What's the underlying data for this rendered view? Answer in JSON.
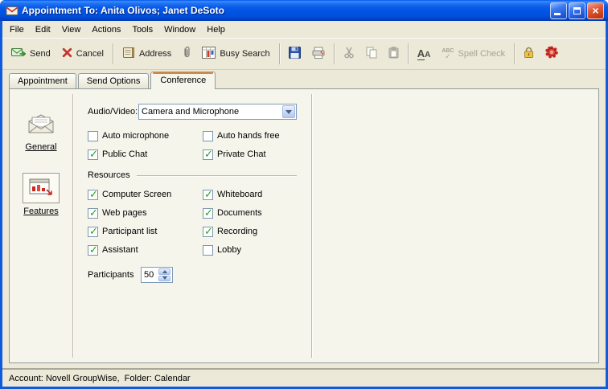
{
  "window": {
    "title": "Appointment To: Anita Olivos; Janet DeSoto"
  },
  "menubar": {
    "items": [
      {
        "label": "File"
      },
      {
        "label": "Edit"
      },
      {
        "label": "View"
      },
      {
        "label": "Actions"
      },
      {
        "label": "Tools"
      },
      {
        "label": "Window"
      },
      {
        "label": "Help"
      }
    ]
  },
  "toolbar": {
    "send": "Send",
    "cancel": "Cancel",
    "address": "Address",
    "busy_search": "Busy Search",
    "font_large": "A",
    "font_small": "A",
    "spell_abc": "ABC",
    "spell_check": "Spell Check"
  },
  "tabs": {
    "items": [
      {
        "label": "Appointment",
        "active": false
      },
      {
        "label": "Send Options",
        "active": false
      },
      {
        "label": "Conference",
        "active": true
      }
    ]
  },
  "sidebar": {
    "general_label": "General",
    "features_label": "Features"
  },
  "form": {
    "audio_video_label": "Audio/Video:",
    "audio_video_value": "Camera and Microphone",
    "options": [
      {
        "label": "Auto microphone",
        "checked": false
      },
      {
        "label": "Auto hands free",
        "checked": false
      },
      {
        "label": "Public Chat",
        "checked": true
      },
      {
        "label": "Private Chat",
        "checked": true
      }
    ],
    "resources_label": "Resources",
    "resources": [
      {
        "label": "Computer Screen",
        "checked": true
      },
      {
        "label": "Whiteboard",
        "checked": true
      },
      {
        "label": "Web pages",
        "checked": true
      },
      {
        "label": "Documents",
        "checked": true
      },
      {
        "label": "Participant list",
        "checked": true
      },
      {
        "label": "Recording",
        "checked": true
      },
      {
        "label": "Assistant",
        "checked": true
      },
      {
        "label": "Lobby",
        "checked": false
      }
    ],
    "participants_label": "Participants",
    "participants_value": "50"
  },
  "statusbar": {
    "text": "Account: Novell GroupWise,  Folder: Calendar"
  },
  "colors": {
    "titlebar_blue": "#0054E3",
    "chrome_tan": "#ECE9D8",
    "page_cream": "#F6F5EC",
    "check_green": "#21A121",
    "disabled_text": "#A8A494",
    "active_tab_accent": "#E5822D"
  }
}
